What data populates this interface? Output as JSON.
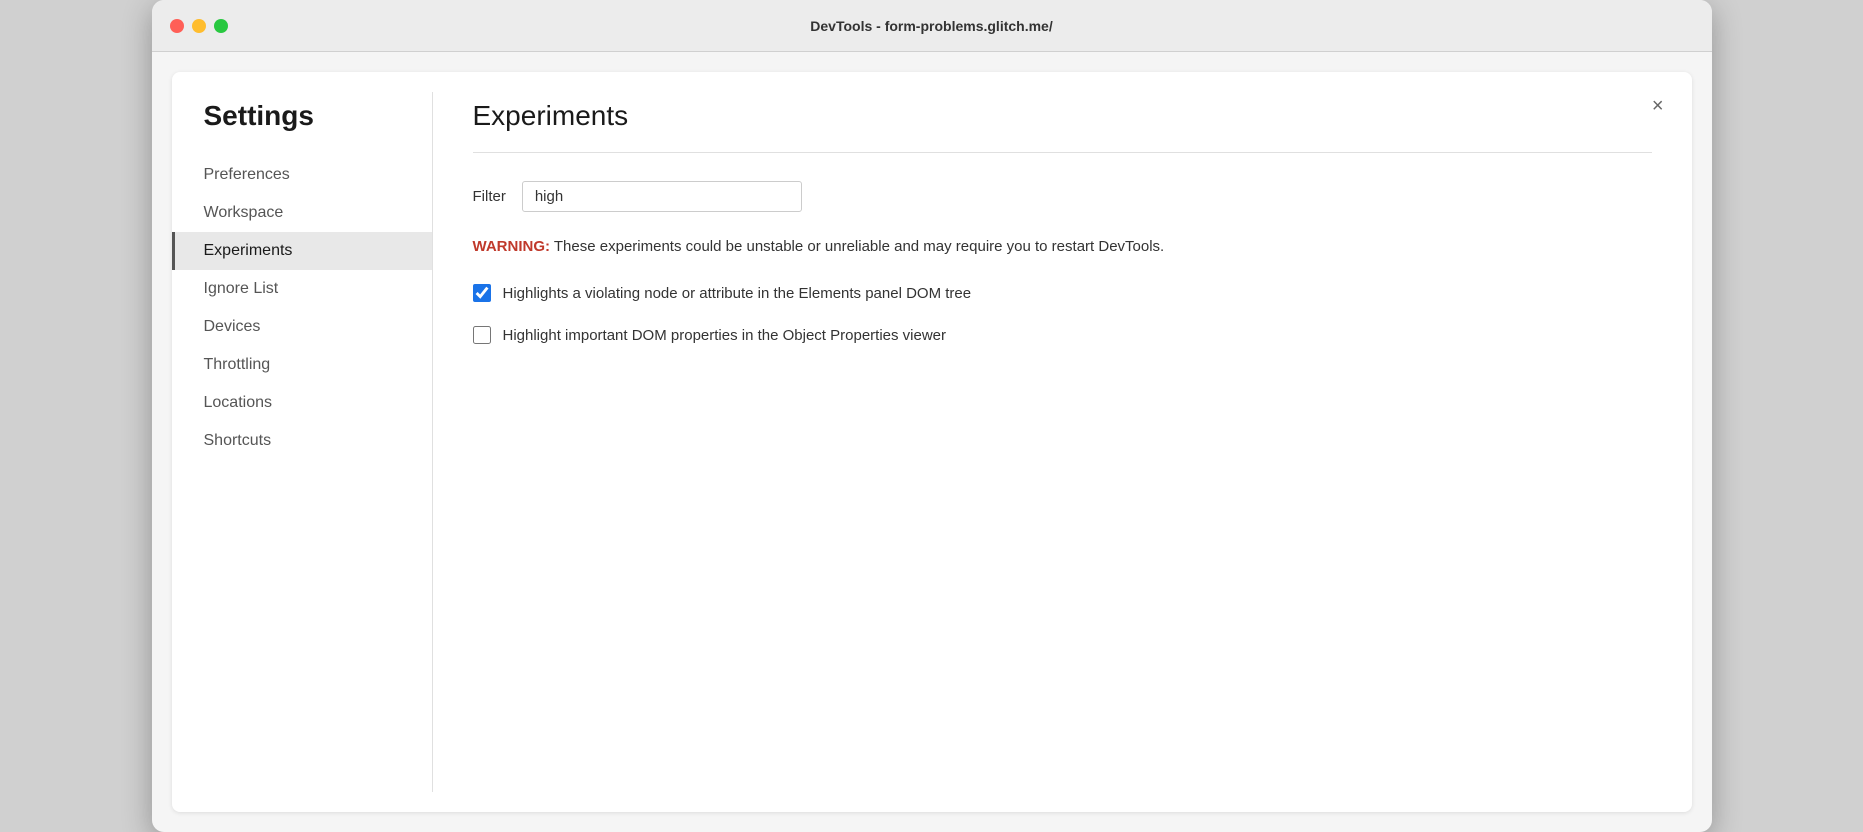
{
  "window": {
    "title": "DevTools - form-problems.glitch.me/"
  },
  "sidebar": {
    "heading": "Settings",
    "items": [
      {
        "id": "preferences",
        "label": "Preferences",
        "active": false
      },
      {
        "id": "workspace",
        "label": "Workspace",
        "active": false
      },
      {
        "id": "experiments",
        "label": "Experiments",
        "active": true
      },
      {
        "id": "ignore-list",
        "label": "Ignore List",
        "active": false
      },
      {
        "id": "devices",
        "label": "Devices",
        "active": false
      },
      {
        "id": "throttling",
        "label": "Throttling",
        "active": false
      },
      {
        "id": "locations",
        "label": "Locations",
        "active": false
      },
      {
        "id": "shortcuts",
        "label": "Shortcuts",
        "active": false
      }
    ]
  },
  "main": {
    "title": "Experiments",
    "filter": {
      "label": "Filter",
      "value": "high",
      "placeholder": ""
    },
    "warning": {
      "prefix": "WARNING:",
      "text": " These experiments could be unstable or unreliable and may require you to restart DevTools."
    },
    "checkboxes": [
      {
        "id": "checkbox-1",
        "label": "Highlights a violating node or attribute in the Elements panel DOM tree",
        "checked": true
      },
      {
        "id": "checkbox-2",
        "label": "Highlight important DOM properties in the Object Properties viewer",
        "checked": false
      }
    ]
  },
  "close_button_label": "×"
}
